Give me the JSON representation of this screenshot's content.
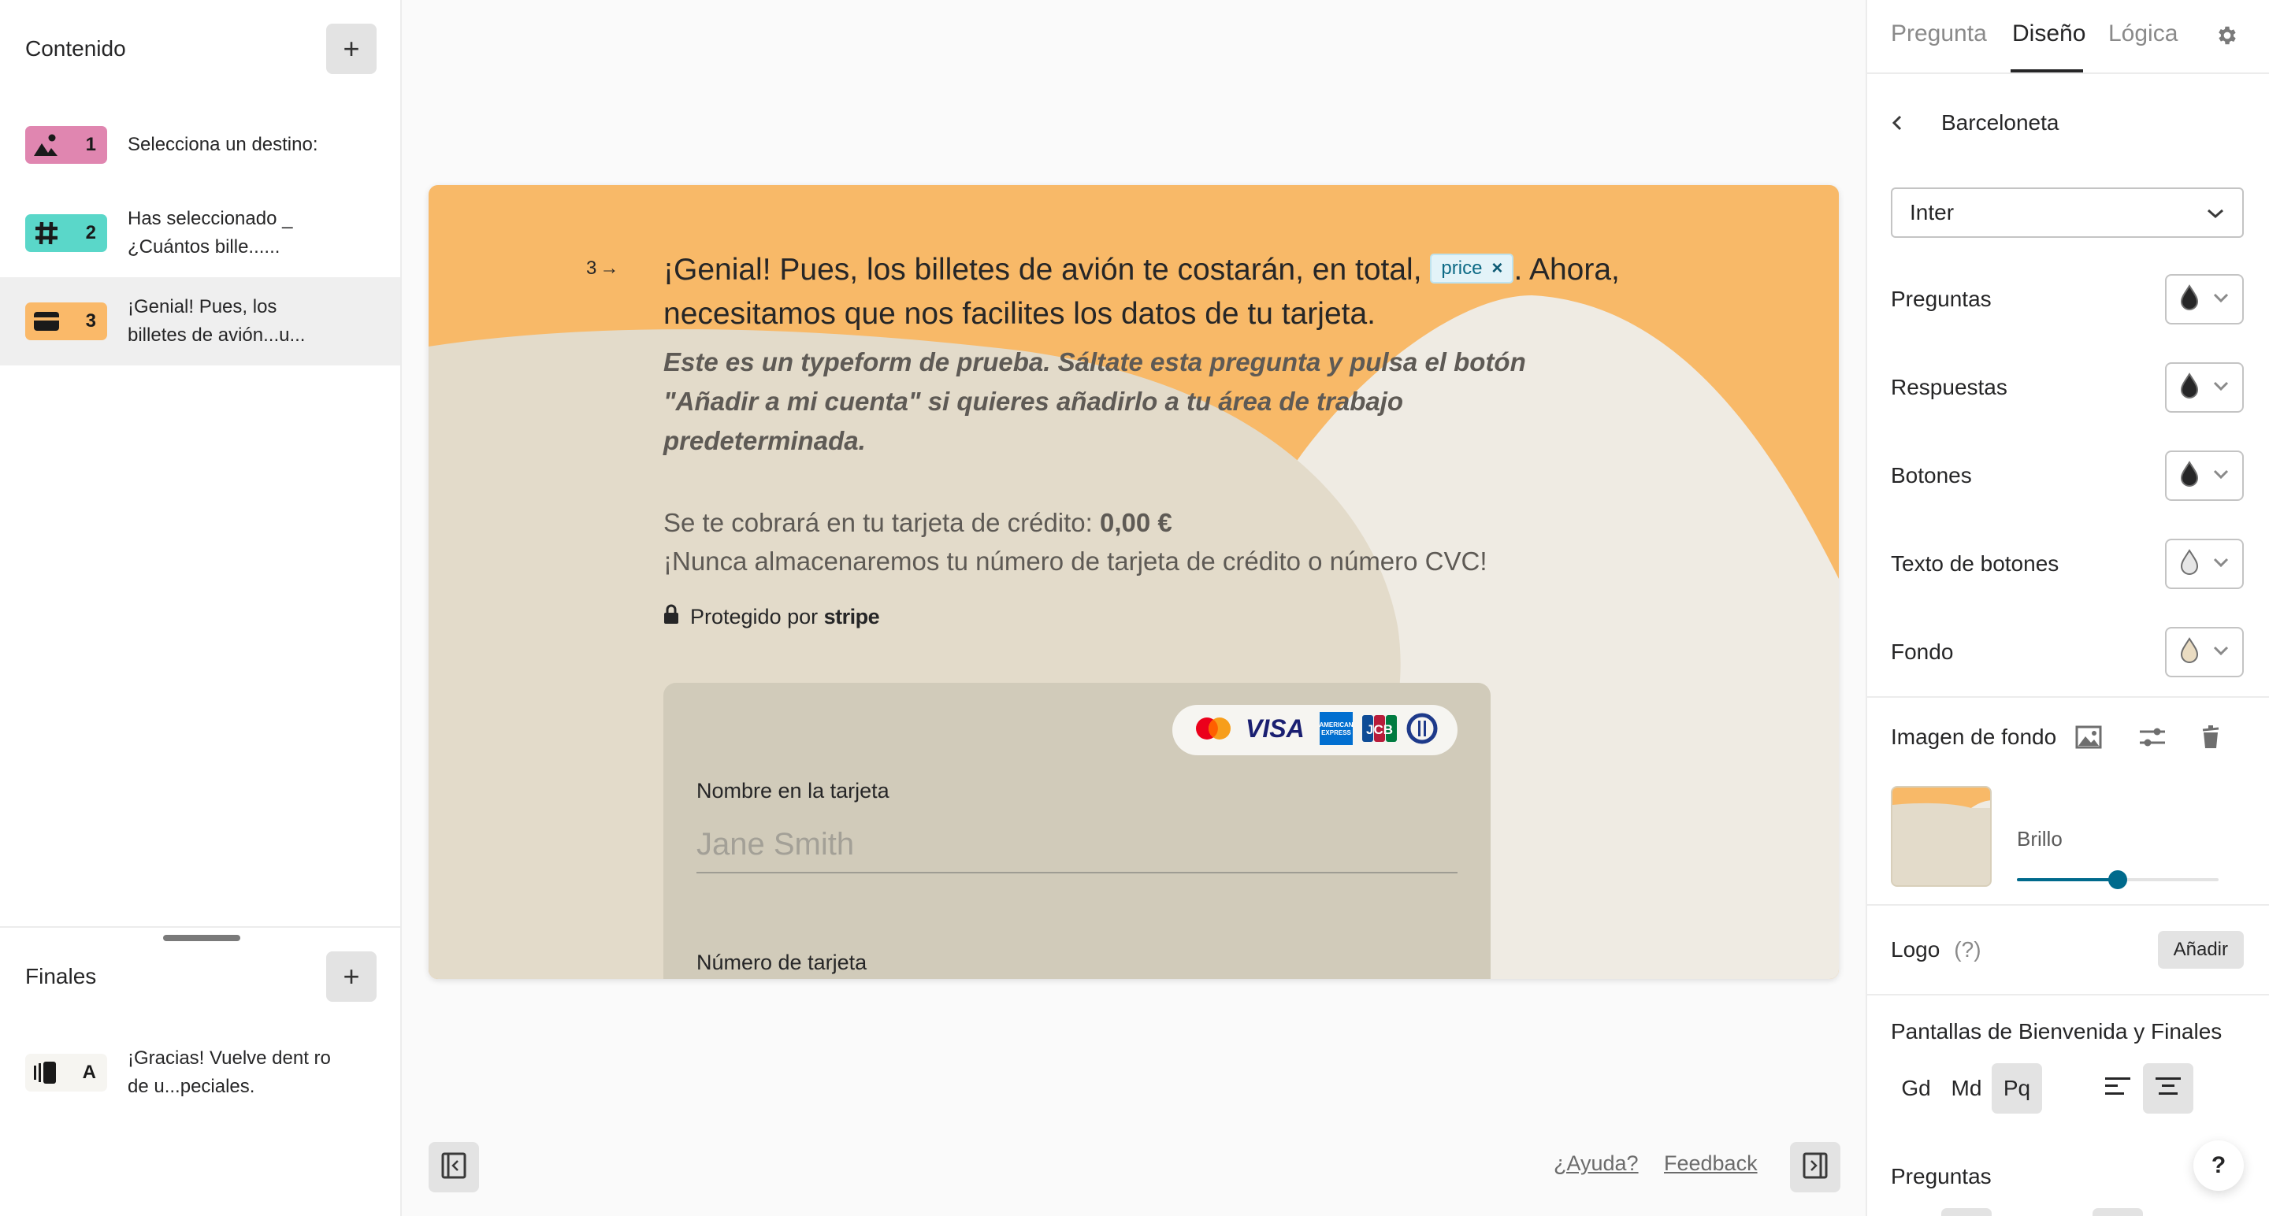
{
  "left": {
    "content_title": "Contenido",
    "add_content_label": "+",
    "questions": [
      {
        "number": "1",
        "icon": "image-icon",
        "color": "#e086b0",
        "text": "Selecciona un destino:",
        "active": false
      },
      {
        "number": "2",
        "icon": "hash-icon",
        "color": "#5ad7c9",
        "text": "Has seleccionado _ ¿Cuántos bille......",
        "active": false
      },
      {
        "number": "3",
        "icon": "credit-card-icon",
        "color": "#fab969",
        "text": "¡Genial! Pues, los billetes de avión...u...",
        "active": true
      }
    ],
    "endings_title": "Finales",
    "add_ending_label": "+",
    "endings": [
      {
        "letter": "A",
        "icon": "ending-screen-icon",
        "color": "#f6f5f1",
        "text": "¡Gracias! Vuelve dent ro de u...peciales."
      }
    ]
  },
  "card": {
    "question_number": "3",
    "arrow": "→",
    "title_before": "¡Genial! Pues, los billetes de avión te costarán, en total,",
    "price_tag": "price",
    "price_tag_remove": "×",
    "title_after": ". Ahora, necesitamos que nos facilites los datos de tu tarjeta.",
    "description": "Este es un typeform de prueba. Sáltate esta pregunta y pulsa el botón \"Añadir a mi cuenta\" si quieres añadirlo a tu área de trabajo predeterminada.",
    "charge_text": "Se te cobrará en tu tarjeta de crédito:",
    "charge_amount": "0,00 €",
    "never_store": "¡Nunca almacenaremos tu número de tarjeta de crédito o número CVC!",
    "protected_by": "Protegido por",
    "stripe_brand": "stripe",
    "card_brands": [
      "mastercard",
      "visa",
      "american-express",
      "jcb",
      "diners-club"
    ],
    "name_label": "Nombre en la tarjeta",
    "name_placeholder": "Jane Smith",
    "name_value": "",
    "number_label": "Número de tarjeta",
    "colors": {
      "orange": "#f8b968",
      "beige": "#e3dbca",
      "cream": "#efebe3",
      "box": "#d1cbba"
    }
  },
  "footer": {
    "help_link": "¿Ayuda?",
    "feedback_link": "Feedback"
  },
  "right": {
    "tabs": [
      {
        "label": "Pregunta",
        "active": false
      },
      {
        "label": "Diseño",
        "active": true
      },
      {
        "label": "Lógica",
        "active": false
      }
    ],
    "theme_name": "Barceloneta",
    "font_select": "Inter",
    "colors": [
      {
        "label": "Preguntas",
        "swatch": "#262627"
      },
      {
        "label": "Respuestas",
        "swatch": "#262627"
      },
      {
        "label": "Botones",
        "swatch": "#262627"
      },
      {
        "label": "Texto de botones",
        "swatch": "#e6e6e6"
      },
      {
        "label": "Fondo",
        "swatch": "#eadcc2"
      }
    ],
    "bg_image_label": "Imagen de fondo",
    "brightness_label": "Brillo",
    "brightness_value": 0.5,
    "logo_label": "Logo",
    "logo_help": "(?)",
    "logo_add": "Añadir",
    "screens_title": "Pantallas de Bienvenida y Finales",
    "sizes": [
      {
        "label": "Gd",
        "selected": false
      },
      {
        "label": "Md",
        "selected": false
      },
      {
        "label": "Pq",
        "selected": true
      }
    ],
    "alignments": [
      {
        "name": "align-left",
        "selected": false
      },
      {
        "name": "align-center",
        "selected": true
      }
    ],
    "questions_title": "Preguntas",
    "help_fab": "?"
  }
}
